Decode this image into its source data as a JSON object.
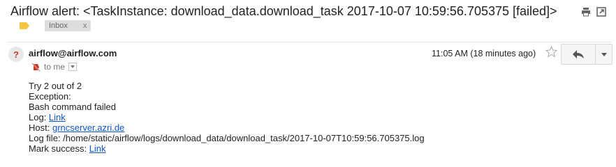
{
  "subject": "Airflow alert: <TaskInstance: download_data.download_task 2017-10-07 10:59:56.705375 [failed]>",
  "labels": {
    "inbox_chip": "Inbox",
    "chip_close": "x"
  },
  "sender": {
    "avatar_glyph": "?",
    "email": "airflow@airflow.com",
    "to_text": "to me"
  },
  "timestamp": "11:05 AM (18 minutes ago)",
  "body": {
    "try_line": "Try 2 out of 2",
    "exception_label": "Exception:",
    "exception_text": "Bash command failed",
    "log_label": "Log: ",
    "log_link": "Link",
    "host_label": "Host: ",
    "host_link": "grncserver.azri.de",
    "logfile_line": "Log file: /home/static/airflow/logs/download_data/download_task/2017-10-07T10:59:56.705375.log",
    "mark_label": "Mark success: ",
    "mark_link": "Link"
  },
  "icons": {
    "print": "print-icon",
    "new_window": "new-window-icon",
    "label_tag": "label-tag-icon",
    "unknown_sender": "question-mark-icon",
    "not_important": "not-important-icon",
    "dropdown": "chevron-down-icon",
    "star": "star-icon",
    "reply": "reply-icon",
    "more": "caret-down-icon"
  },
  "colors": {
    "label_tag": "#f4c542",
    "link": "#1155cc",
    "avatar_glyph": "#c53929",
    "important_marker": "#c53929"
  }
}
